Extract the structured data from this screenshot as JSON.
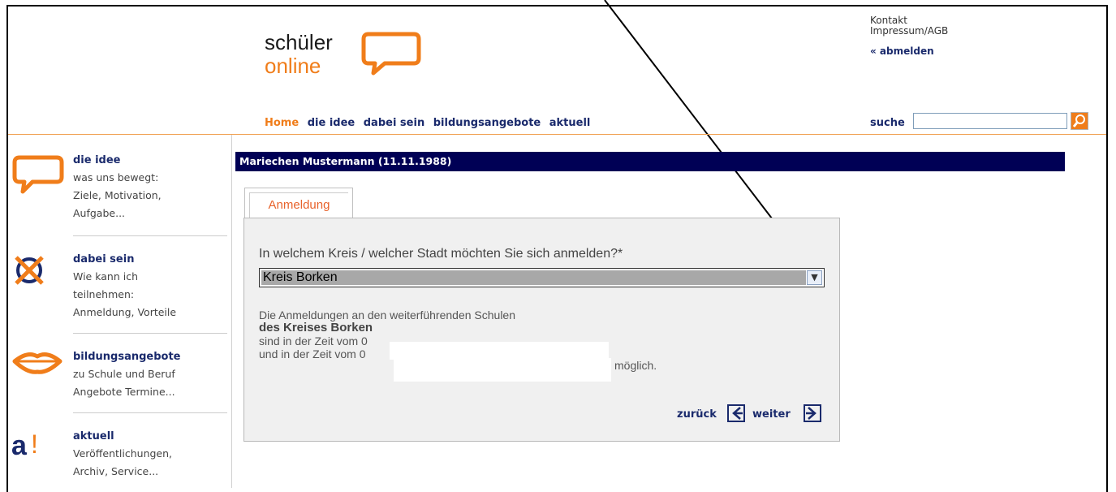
{
  "header": {
    "logo_line1": "schüler",
    "logo_line2": "online",
    "links": [
      "Kontakt",
      "Impressum/AGB"
    ],
    "logout_label": "« abmelden"
  },
  "nav": {
    "items": [
      {
        "label": "Home",
        "active": true
      },
      {
        "label": "die idee",
        "active": false
      },
      {
        "label": "dabei sein",
        "active": false
      },
      {
        "label": "bildungsangebote",
        "active": false
      },
      {
        "label": "aktuell",
        "active": false
      }
    ],
    "search_label": "suche",
    "search_value": ""
  },
  "sidebar": {
    "items": [
      {
        "title": "die idee",
        "desc": "was uns bewegt:\nZiele, Motivation,\nAufgabe...",
        "icon": "speech-bubble-icon"
      },
      {
        "title": "dabei sein",
        "desc": "Wie kann ich\nteilnehmen:\nAnmeldung, Vorteile",
        "icon": "cross-circle-icon"
      },
      {
        "title": "bildungsangebote",
        "desc": "zu Schule und Beruf\nAngebote Termine...",
        "icon": "lips-icon"
      },
      {
        "title": "aktuell",
        "desc": "Veröffentlichungen,\nArchiv, Service...",
        "icon": "a-exclamation-icon"
      }
    ]
  },
  "main": {
    "user_bar": "Mariechen Mustermann (11.11.1988)",
    "tab_label": "Anmeldung",
    "question": "In welchem Kreis / welcher Stadt möchten Sie sich anmelden?*",
    "select_value": "Kreis Borken",
    "info_line1": "Die Anmeldungen an den weiterführenden Schulen",
    "info_line2": "des Kreises Borken",
    "info_line3": "sind in der Zeit vom 0",
    "info_line4": "und in der Zeit vom 0",
    "info_suffix": "möglich.",
    "back_label": "zurück",
    "next_label": "weiter"
  },
  "colors": {
    "brand_orange": "#f07d1a",
    "navy": "#000055",
    "link_blue": "#1a2a6c"
  }
}
